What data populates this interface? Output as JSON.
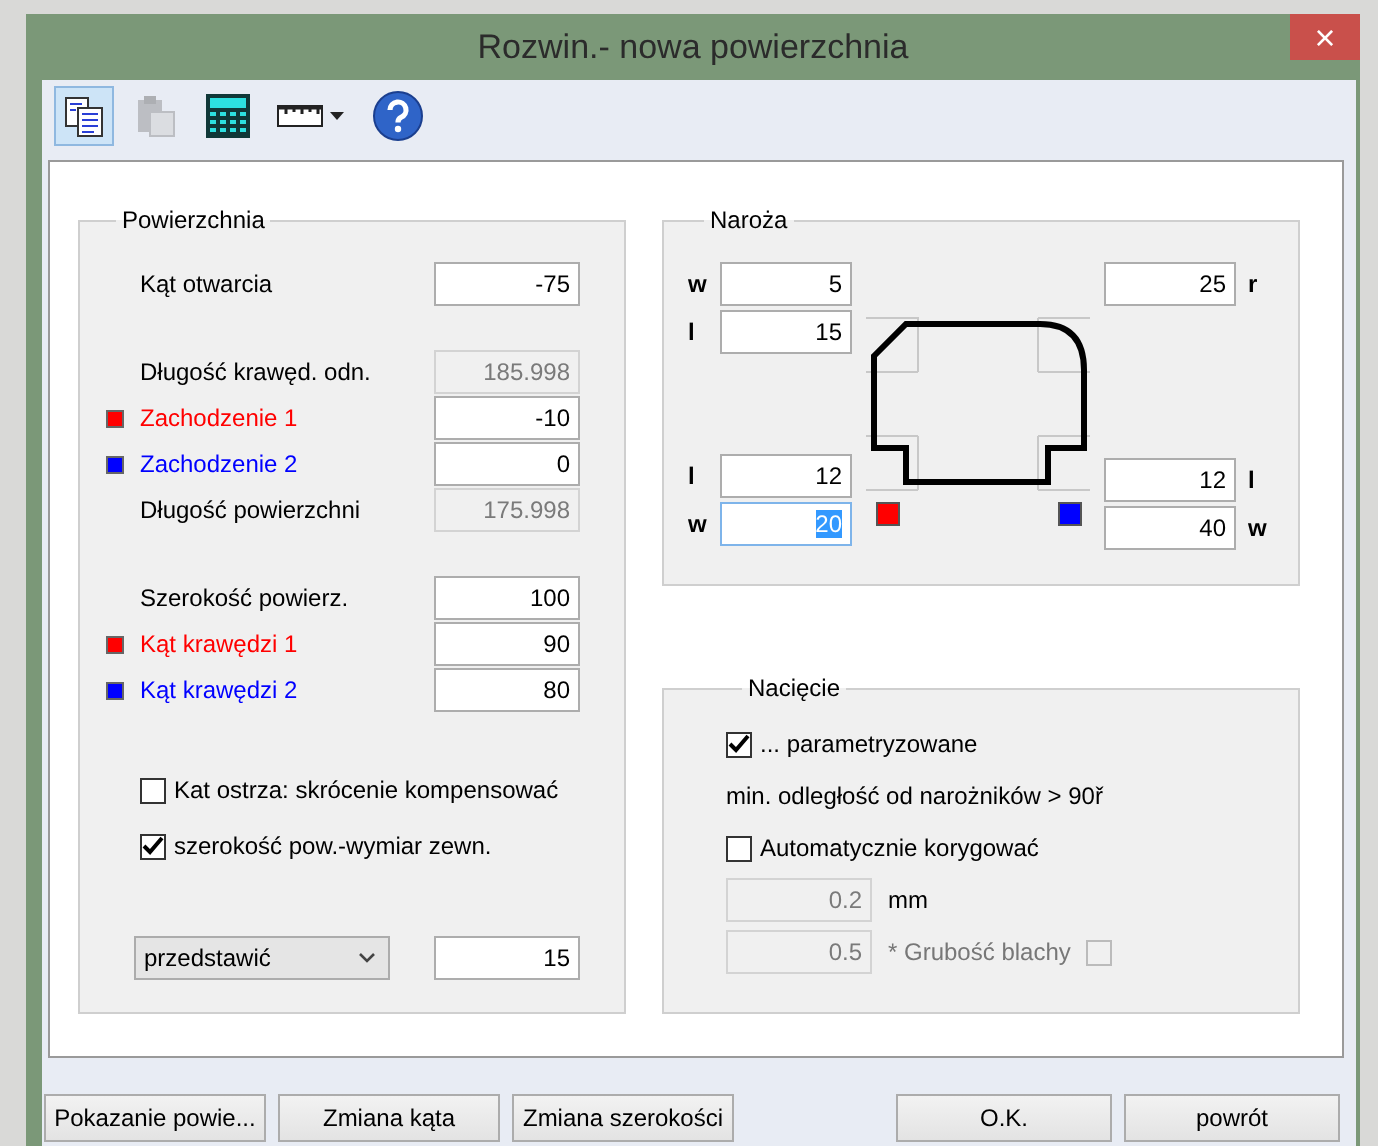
{
  "window": {
    "title": "Rozwin.- nowa powierzchnia",
    "close": "×"
  },
  "toolbar": [
    {
      "kind": "pages",
      "selected": true,
      "disabled": false
    },
    {
      "kind": "clipboard",
      "selected": false,
      "disabled": true
    },
    {
      "kind": "calculator",
      "selected": false,
      "disabled": false
    },
    {
      "kind": "ruler",
      "selected": false,
      "disabled": false
    },
    {
      "kind": "help",
      "selected": false,
      "disabled": false
    }
  ],
  "powierzchnia": {
    "title": "Powierzchnia",
    "groups": [
      [
        {
          "label": "Kąt otwarcia",
          "value": "-75",
          "disabled": false
        }
      ],
      [
        {
          "label": "Długość krawęd. odn.",
          "value": "185.998",
          "disabled": true
        },
        {
          "label": "Zachodzenie 1",
          "value": "-10",
          "disabled": false,
          "color": "#ff0000"
        },
        {
          "label": "Zachodzenie 2",
          "value": "0",
          "disabled": false,
          "color": "#0000ff"
        },
        {
          "label": "Długość powierzchni",
          "value": "175.998",
          "disabled": true
        }
      ],
      [
        {
          "label": "Szerokość powierz.",
          "value": "100",
          "disabled": false
        },
        {
          "label": "Kąt krawędzi 1",
          "value": "90",
          "disabled": false,
          "color": "#ff0000"
        },
        {
          "label": "Kąt krawędzi 2",
          "value": "80",
          "disabled": false,
          "color": "#0000ff"
        }
      ]
    ],
    "checkboxes": [
      {
        "label": "Kat ostrza: skrócenie kompensować",
        "checked": false
      },
      {
        "label": "szerokość pow.-wymiar zewn.",
        "checked": true
      }
    ],
    "dropdown": {
      "value": "przedstawić"
    },
    "dropdown_value": "15"
  },
  "naroza": {
    "title": "Naroża",
    "top_left": [
      {
        "label": "w",
        "value": "5",
        "selected": false
      },
      {
        "label": "l",
        "value": "15",
        "selected": false
      }
    ],
    "top_right": [
      {
        "label": "r",
        "value": "25",
        "selected": false
      }
    ],
    "bottom_left": [
      {
        "label": "l",
        "value": "12",
        "selected": false
      },
      {
        "label": "w",
        "value": "20",
        "selected": true
      }
    ],
    "bottom_right": [
      {
        "label": "l",
        "value": "12",
        "selected": false
      },
      {
        "label": "w",
        "value": "40",
        "selected": false
      }
    ],
    "markers": [
      {
        "color": "#ff0000"
      },
      {
        "color": "#0000ff"
      }
    ]
  },
  "naciecie": {
    "title": "Nacięcie",
    "parametrized": {
      "label": "... parametryzowane",
      "checked": true
    },
    "note": "min. odległość od narożników > 90ř",
    "auto": {
      "label": "Automatycznie korygować",
      "checked": false
    },
    "gap": {
      "value": "0.2",
      "unit": "mm",
      "disabled": true
    },
    "thickness": {
      "value": "0.5",
      "label": "* Grubość blachy",
      "disabled": true,
      "checked": false
    }
  },
  "buttons_left": [
    "Pokazanie powie...",
    "Zmiana kąta",
    "Zmiana szerokości"
  ],
  "buttons_right": [
    "O.K.",
    "powrót"
  ]
}
